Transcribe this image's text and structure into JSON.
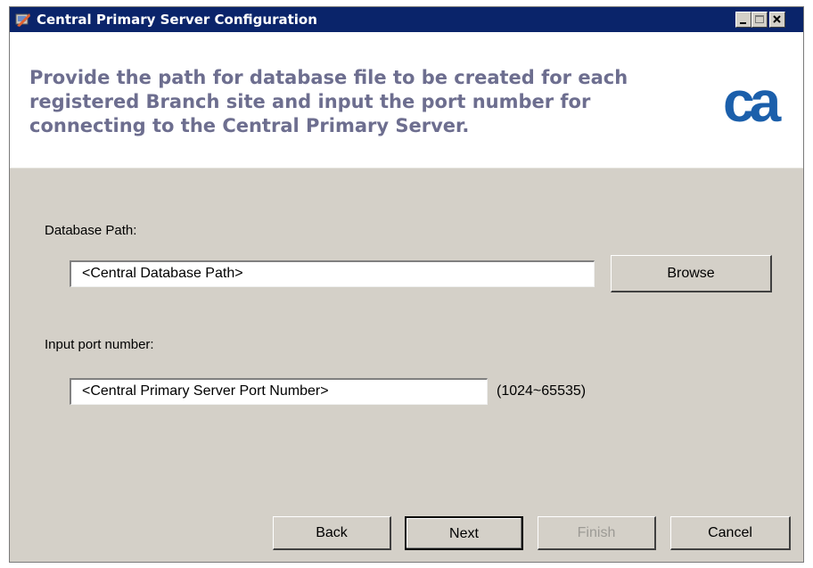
{
  "window": {
    "title": "Central Primary Server Configuration"
  },
  "header": {
    "instruction": "Provide the path for database file to be created for each registered Branch site and input the port number for connecting to the Central Primary Server.",
    "logo_text": "ca",
    "logo_color": "#1b5fab"
  },
  "form": {
    "database_path_label": "Database Path:",
    "database_path_value": "<Central Database Path>",
    "browse_label": "Browse",
    "port_label": "Input port number:",
    "port_value": "<Central Primary Server Port Number>",
    "port_range": "(1024~65535)"
  },
  "footer": {
    "back_label": "Back",
    "next_label": "Next",
    "finish_label": "Finish",
    "cancel_label": "Cancel"
  },
  "icons": [
    "app-icon",
    "minimize-icon",
    "maximize-icon",
    "close-icon"
  ]
}
